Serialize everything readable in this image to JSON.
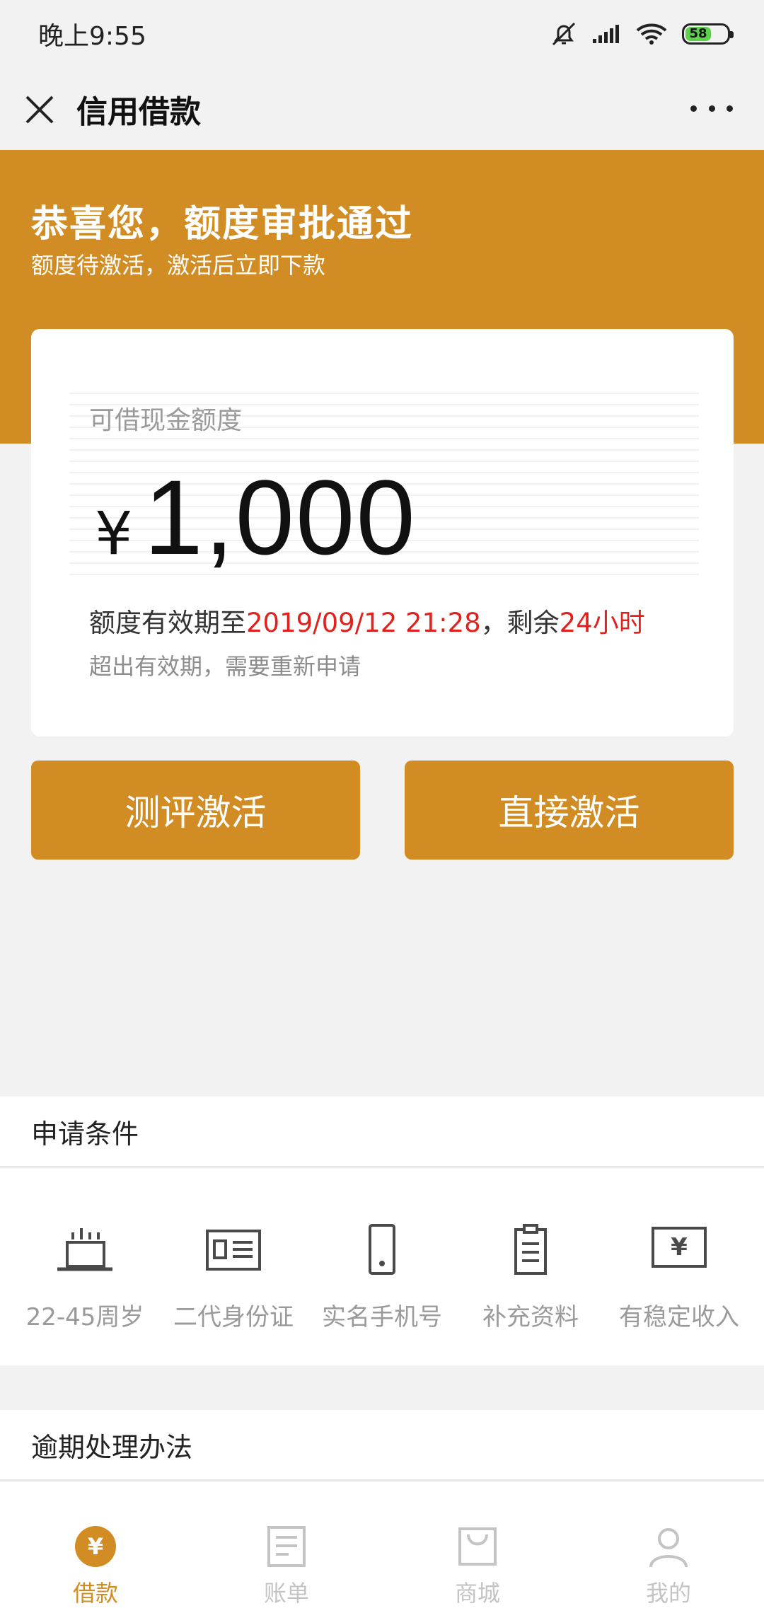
{
  "status_bar": {
    "time": "晚上9:55",
    "battery": "58"
  },
  "nav": {
    "title": "信用借款"
  },
  "banner": {
    "title": "恭喜您，额度审批通过",
    "subtitle": "额度待激活，激活后立即下款"
  },
  "card": {
    "label": "可借现金额度",
    "currency_symbol": "¥",
    "amount": "1,000",
    "validity_prefix": "额度有效期至",
    "validity_date": "2019/09/12 21:28",
    "validity_mid": "，剩余",
    "remaining": "24小时",
    "note": "超出有效期，需要重新申请"
  },
  "buttons": {
    "evaluate": "测评激活",
    "direct": "直接激活"
  },
  "apply_conditions": {
    "title": "申请条件",
    "items": [
      {
        "icon": "cake-icon",
        "label": "22-45周岁"
      },
      {
        "icon": "id-card-icon",
        "label": "二代身份证"
      },
      {
        "icon": "phone-icon",
        "label": "实名手机号"
      },
      {
        "icon": "clipboard-icon",
        "label": "补充资料"
      },
      {
        "icon": "income-icon",
        "label": "有稳定收入"
      }
    ]
  },
  "overdue": {
    "title": "逾期处理办法"
  },
  "tabbar": {
    "items": [
      {
        "icon": "yen-coin-icon",
        "label": "借款",
        "active": true
      },
      {
        "icon": "bill-icon",
        "label": "账单",
        "active": false
      },
      {
        "icon": "shop-icon",
        "label": "商城",
        "active": false
      },
      {
        "icon": "user-icon",
        "label": "我的",
        "active": false
      }
    ]
  },
  "colors": {
    "accent": "#d28c24",
    "highlight": "#e0221e",
    "background": "#f2f2f3"
  }
}
